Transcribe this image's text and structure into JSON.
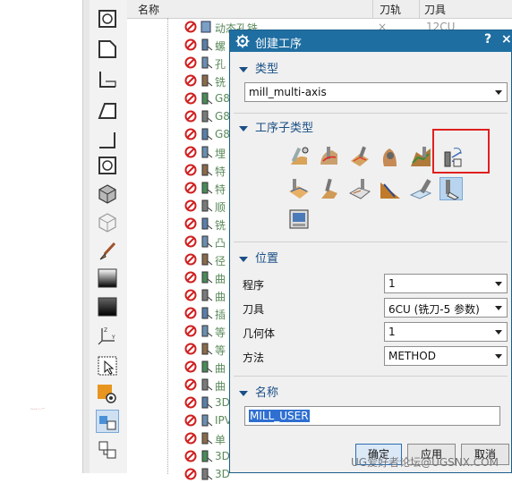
{
  "navigator": {
    "col_name": "名称",
    "col_path": "刀轨",
    "col_tool": "刀具",
    "first_row_name": "动态孔铣",
    "first_row_tool": "12CU",
    "rows": [
      "螺",
      "孔",
      "铣",
      "G8",
      "G8",
      "G8",
      "埋",
      "特",
      "特",
      "顺",
      "铣",
      "凸",
      "径",
      "曲",
      "曲",
      "插",
      "等",
      "等",
      "曲",
      "曲",
      "3D",
      "IPV",
      "单",
      "3D",
      "3D"
    ]
  },
  "dialog": {
    "title": "创建工序",
    "help_label": "?",
    "close_label": "×",
    "section_type": "类型",
    "type_value": "mill_multi-axis",
    "section_subtype": "工序子类型",
    "subtype_icons": [
      "swarf-icon",
      "variable-contour-icon",
      "variable-streamline-icon",
      "contour-profile-icon",
      "fixed-contour-icon",
      "drill-axis-icon",
      "generic-motion-icon",
      "multi-blade-icon",
      "tube-finish-icon",
      "deburring-icon",
      "multi-axis-rough-icon",
      "multi-axis-finish-icon",
      "mill-user-icon"
    ],
    "section_location": "位置",
    "program_label": "程序",
    "program_value": "1",
    "tool_label": "刀具",
    "tool_value": "6CU (铣刀-5 参数)",
    "geometry_label": "几何体",
    "geometry_value": "1",
    "method_label": "方法",
    "method_value": "METHOD",
    "section_name": "名称",
    "name_value": "MILL_USER",
    "ok_label": "确定",
    "apply_label": "应用",
    "cancel_label": "取消"
  },
  "toolbar_icons": [
    "cylinder-icon",
    "box-chamfer-icon",
    "l-shape-icon",
    "wedge-icon",
    "corner-icon",
    "cylinder-outline-icon",
    "solid-box-icon",
    "wireframe-box-icon",
    "brush-icon",
    "gradient-icon",
    "gradient-dark-icon",
    "axis-icon",
    "select-icon",
    "settings-icon",
    "toolpath-icon",
    "toolpath-2-icon"
  ],
  "watermark": "UG爱好者论坛@UGSNX.COM",
  "colors": {
    "title_bar": "#1f6ea2",
    "section_text": "#1a4f86",
    "highlight_box": "#e02020",
    "selection": "#2e6fd1"
  }
}
